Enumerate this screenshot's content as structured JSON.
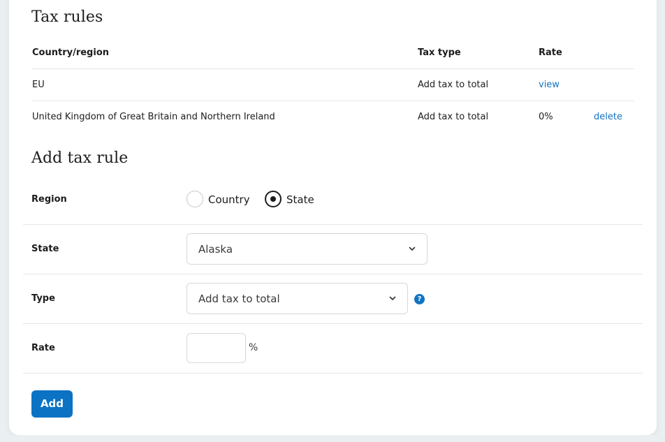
{
  "tax_rules": {
    "title": "Tax rules",
    "headers": {
      "region": "Country/region",
      "type": "Tax type",
      "rate": "Rate"
    },
    "rows": [
      {
        "region": "EU",
        "type": "Add tax to total",
        "rate": "view",
        "action": ""
      },
      {
        "region": "United Kingdom of Great Britain and Northern Ireland",
        "type": "Add tax to total",
        "rate": "0%",
        "action": "delete"
      }
    ]
  },
  "add_rule": {
    "title": "Add tax rule",
    "region_label": "Region",
    "region_options": [
      "Country",
      "State"
    ],
    "region_selected": "State",
    "state_label": "State",
    "state_value": "Alaska",
    "type_label": "Type",
    "type_value": "Add tax to total",
    "rate_label": "Rate",
    "rate_value": "",
    "rate_unit": "%",
    "help_glyph": "?",
    "add_label": "Add"
  },
  "icons": {
    "chevron": "chevron-down-icon",
    "help": "help-icon"
  },
  "colors": {
    "accent": "#1273c3",
    "button": "#0b72c4",
    "background": "#eaeff1"
  }
}
